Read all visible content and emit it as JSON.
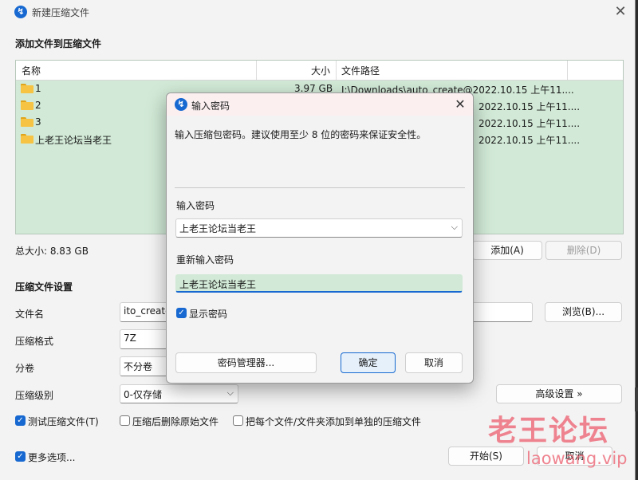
{
  "window": {
    "title": "新建压缩文件",
    "app_icon_glyph": "↯",
    "close_glyph": "✕"
  },
  "add_section": {
    "title": "添加文件到压缩文件"
  },
  "filelist": {
    "headers": {
      "name": "名称",
      "size": "大小",
      "path": "文件路径"
    },
    "rows": [
      {
        "name": "1",
        "size": "3.97 GB",
        "path": "I:\\Downloads\\auto_create@2022.10.15 上午11...."
      },
      {
        "name": "2",
        "size": "",
        "path": "2022.10.15 上午11...."
      },
      {
        "name": "3",
        "size": "",
        "path": "2022.10.15 上午11...."
      },
      {
        "name": "上老王论坛当老王",
        "size": "",
        "path": "2022.10.15 上午11...."
      }
    ],
    "row_bg": "#d1e9d6"
  },
  "total_size": "总大小: 8.83 GB",
  "buttons": {
    "add": "添加(A)",
    "delete": "删除(D)",
    "browse": "浏览(B)...",
    "advanced": "高级设置 »",
    "start": "开始(S)",
    "cancel": "取消"
  },
  "settings": {
    "title": "压缩文件设置",
    "filename_label": "文件名",
    "filename_value": "ito_create",
    "format_label": "压缩格式",
    "format_value": "7Z",
    "split_label": "分卷",
    "split_value": "不分卷",
    "level_label": "压缩级别",
    "level_value": "0-仅存储"
  },
  "options": {
    "test": {
      "label": "测试压缩文件(T)",
      "checked": true
    },
    "delete_source": {
      "label": "压缩后删除原始文件",
      "checked": false
    },
    "separate": {
      "label": "把每个文件/文件夹添加到单独的压缩文件",
      "checked": false
    },
    "more": {
      "label": "更多选项...",
      "checked": true
    }
  },
  "dialog": {
    "title": "输入密码",
    "close_glyph": "✕",
    "message": "输入压缩包密码。建议使用至少 8 位的密码来保证安全性。",
    "password_label": "输入密码",
    "password_value": "上老王论坛当老王",
    "repeat_label": "重新输入密码",
    "repeat_value": "上老王论坛当老王",
    "show_password": {
      "label": "显示密码",
      "checked": true
    },
    "manager_button": "密码管理器...",
    "ok_button": "确定",
    "cancel_button": "取消"
  },
  "watermark": {
    "cn": "老王论坛",
    "en": "laowang.vip"
  },
  "colors": {
    "accent": "#1769d1",
    "list_bg": "#d1e9d6",
    "dialog_title_bg": "#fbeff0",
    "watermark": "#ec6e7d"
  }
}
